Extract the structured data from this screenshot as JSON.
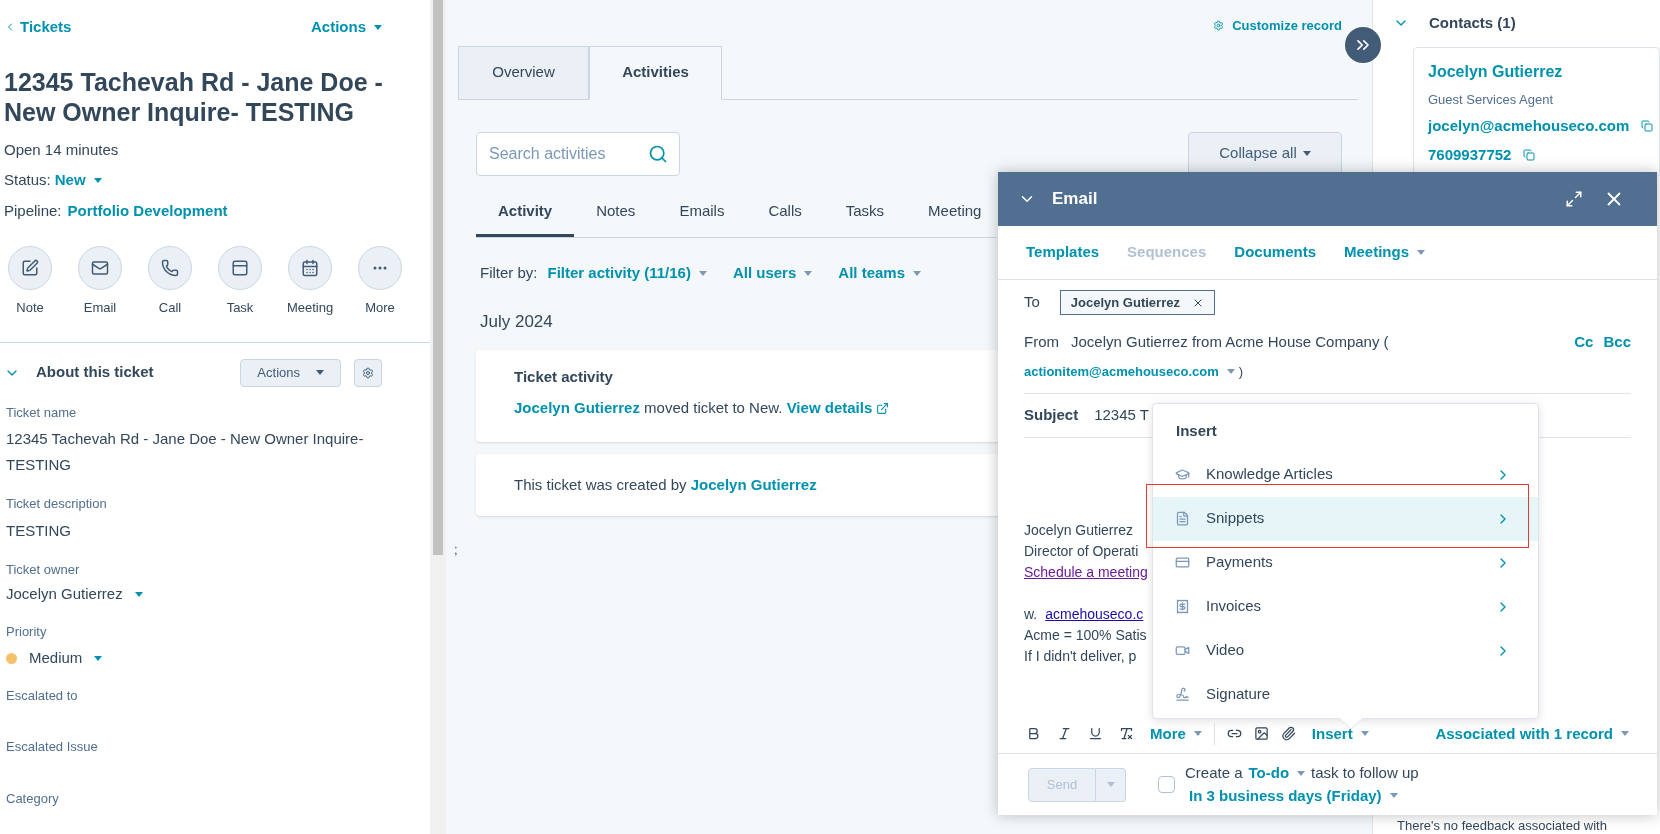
{
  "left": {
    "back": "Tickets",
    "actions": "Actions",
    "title": "12345 Tachevah Rd - Jane Doe - New Owner Inquire- TESTING",
    "open": "Open 14 minutes",
    "status": {
      "label": "Status:",
      "value": "New"
    },
    "pipeline": {
      "label": "Pipeline:",
      "value": "Portfolio Development"
    },
    "quick_actions": [
      {
        "kind": "note",
        "label": "Note"
      },
      {
        "kind": "email",
        "label": "Email"
      },
      {
        "kind": "call",
        "label": "Call"
      },
      {
        "kind": "task",
        "label": "Task"
      },
      {
        "kind": "meeting",
        "label": "Meeting"
      },
      {
        "kind": "more",
        "label": "More"
      }
    ],
    "about": {
      "title": "About this ticket",
      "expanded": true,
      "actions": "Actions"
    },
    "fields": [
      {
        "kind": "text",
        "label": "Ticket name",
        "value": "12345 Tachevah Rd - Jane Doe - New Owner Inquire- TESTING"
      },
      {
        "kind": "text",
        "label": "Ticket description",
        "value": "TESTING"
      },
      {
        "kind": "dropdown",
        "label": "Ticket owner",
        "value": "Jocelyn Gutierrez"
      },
      {
        "kind": "priority",
        "label": "Priority",
        "value": "Medium",
        "color": "#f5c26b"
      },
      {
        "kind": "empty",
        "label": "Escalated to"
      },
      {
        "kind": "empty",
        "label": "Escalated Issue"
      },
      {
        "kind": "empty",
        "label": "Category"
      }
    ]
  },
  "middle": {
    "customize": "Customize record",
    "tabs": [
      {
        "label": "Overview",
        "selected": false
      },
      {
        "label": "Activities",
        "selected": true
      }
    ],
    "search": {
      "placeholder": "Search activities"
    },
    "collapse": "Collapse all",
    "activity_tabs": [
      {
        "label": "Activity",
        "selected": true
      },
      {
        "label": "Notes",
        "selected": false
      },
      {
        "label": "Emails",
        "selected": false
      },
      {
        "label": "Calls",
        "selected": false
      },
      {
        "label": "Tasks",
        "selected": false
      },
      {
        "label": "Meeting",
        "selected": false
      }
    ],
    "filter_label": "Filter by:",
    "filters": [
      "Filter activity (11/16)",
      "All users",
      "All teams"
    ],
    "month": "July 2024",
    "activity_card": {
      "title": "Ticket activity",
      "actor": "Jocelyn Gutierrez",
      "text": "moved ticket to New.",
      "link": "View details"
    },
    "created_card": {
      "text": "This ticket was created by",
      "actor": "Jocelyn Gutierrez"
    },
    "stray": ";"
  },
  "right": {
    "section": "Contacts (1)",
    "expanded": true,
    "contact": {
      "name": "Jocelyn Gutierrez",
      "role": "Guest Services Agent",
      "email": "jocelyn@acmehouseco.com",
      "phone": "7609937752"
    },
    "footer_text": "There's no feedback associated with"
  },
  "email": {
    "title": "Email",
    "tools": [
      {
        "label": "Templates",
        "disabled": false,
        "dropdown": false
      },
      {
        "label": "Sequences",
        "disabled": true,
        "dropdown": false
      },
      {
        "label": "Documents",
        "disabled": false,
        "dropdown": false
      },
      {
        "label": "Meetings",
        "disabled": false,
        "dropdown": true
      }
    ],
    "to_label": "To",
    "to": [
      "Jocelyn Gutierrez"
    ],
    "from_label": "From",
    "from": "Jocelyn Gutierrez from Acme House Company (",
    "from_address": "actionitem@acmehouseco.com",
    "from_close": ")",
    "cc": "Cc",
    "bcc": "Bcc",
    "subject_label": "Subject",
    "subject": "12345 T",
    "body": [
      {
        "kind": "text",
        "text": "Jocelyn Gutierrez"
      },
      {
        "kind": "text",
        "text": "Director of Operati"
      },
      {
        "kind": "meeting_link",
        "text": "Schedule a meeting"
      },
      {
        "kind": "blank"
      },
      {
        "kind": "web",
        "prefix": "w.",
        "text": "acmehouseco.c"
      },
      {
        "kind": "text",
        "text": "Acme = 100% Satis"
      },
      {
        "kind": "text",
        "text": "If I didn't deliver, p"
      }
    ],
    "more": "More",
    "insert": "Insert",
    "associated": "Associated with 1 record",
    "send": {
      "label": "Send",
      "disabled": true
    },
    "followup": {
      "checked": false,
      "prefix": "Create a",
      "type": "To-do",
      "suffix": "task to follow up",
      "when": "In 3 business days (Friday)"
    }
  },
  "insert_menu": {
    "title": "Insert",
    "items": [
      {
        "kind": "knowledge",
        "label": "Knowledge Articles",
        "submenu": true,
        "selected": false
      },
      {
        "kind": "snippets",
        "label": "Snippets",
        "submenu": true,
        "selected": true
      },
      {
        "kind": "payments",
        "label": "Payments",
        "submenu": true,
        "selected": false
      },
      {
        "kind": "invoices",
        "label": "Invoices",
        "submenu": true,
        "selected": false
      },
      {
        "kind": "video",
        "label": "Video",
        "submenu": true,
        "selected": false
      },
      {
        "kind": "signature",
        "label": "Signature",
        "submenu": false,
        "selected": false
      }
    ],
    "highlight_box": true
  }
}
